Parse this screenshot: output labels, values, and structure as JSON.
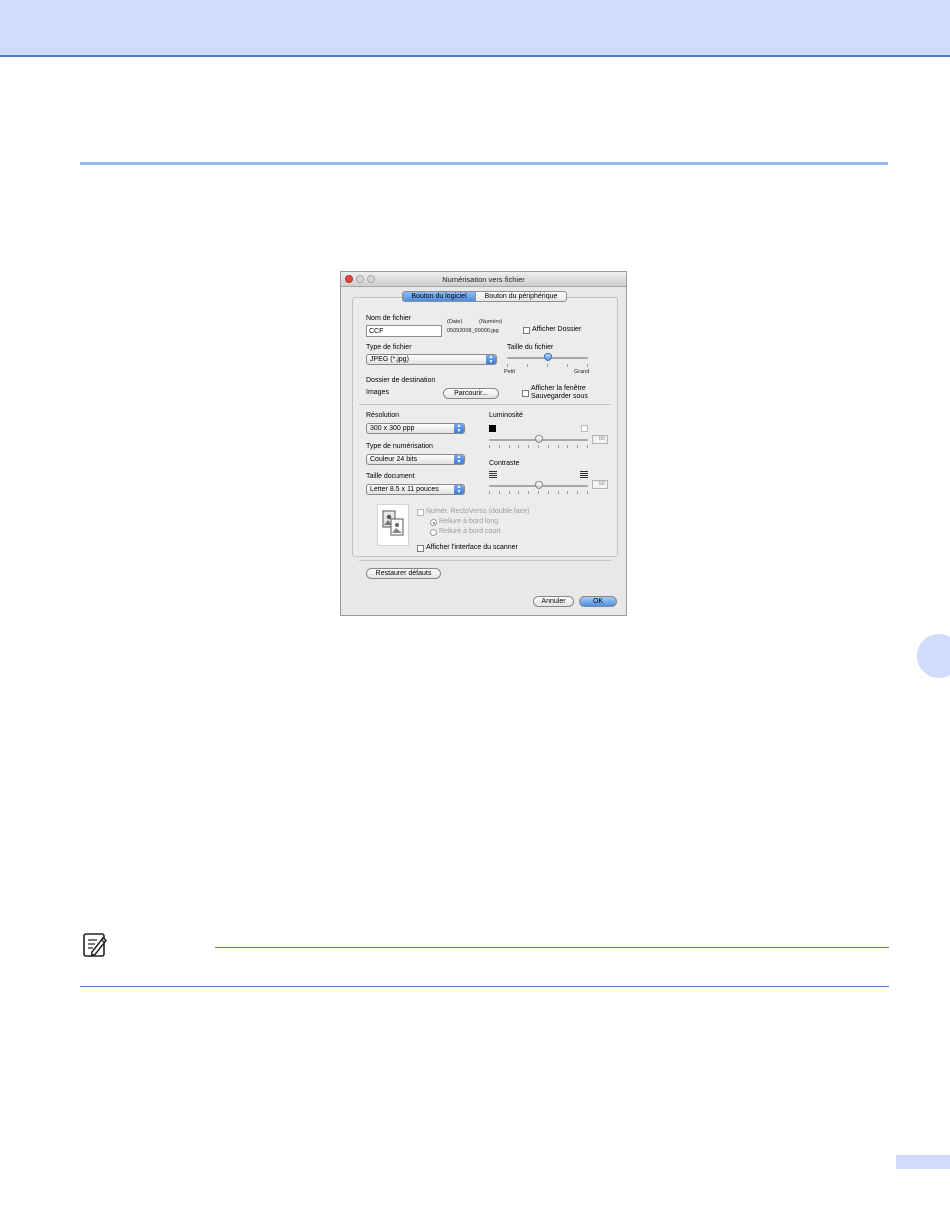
{
  "dialog": {
    "title": "Numérisation vers fichier",
    "tabs": [
      {
        "label": "Bouton du logiciel",
        "selected": true
      },
      {
        "label": "Bouton du périphérique",
        "selected": false
      }
    ],
    "file_name": {
      "label": "Nom de fichier",
      "value": "CCF",
      "date_label": "(Date)",
      "number_label": "(Numéro)",
      "example": "05092008_00000.jpg",
      "show_folder_label": "Afficher Dossier"
    },
    "file_type": {
      "label": "Type de fichier",
      "value": "JPEG (*.jpg)"
    },
    "file_size": {
      "label": "Taille du fichier",
      "min_label": "Petit",
      "max_label": "Grand",
      "level_fraction": 0.5
    },
    "destination": {
      "label": "Dossier de destination",
      "value": "Images",
      "browse_label": "Parcourir...",
      "save_as_line1": "Afficher la fenêtre",
      "save_as_line2": "Sauvegarder sous"
    },
    "resolution": {
      "label": "Résolution",
      "value": "300 x 300 ppp"
    },
    "scan_type": {
      "label": "Type de numérisation",
      "value": "Couleur 24 bits"
    },
    "document_size": {
      "label": "Taille document",
      "value": "Letter  8.5 x 11 pouces"
    },
    "brightness": {
      "label": "Luminosité",
      "value": "50",
      "level_fraction": 0.5
    },
    "contrast": {
      "label": "Contraste",
      "value": "50",
      "level_fraction": 0.5
    },
    "duplex": {
      "label": "Numér. RectoVerso (double face)",
      "long_edge": "Reliure à bord long",
      "short_edge": "Reliure à bord court"
    },
    "show_scanner_ui_label": "Afficher l'interface du scanner",
    "restore_defaults_label": "Restaurer défauts",
    "cancel_label": "Annuler",
    "ok_label": "OK"
  },
  "colors": {
    "header_band": "#cfdcfd",
    "accent_rule": "#4f79c9",
    "section_rule": "#9ab4ec"
  },
  "icons": {
    "note": "note-pencil-icon"
  }
}
